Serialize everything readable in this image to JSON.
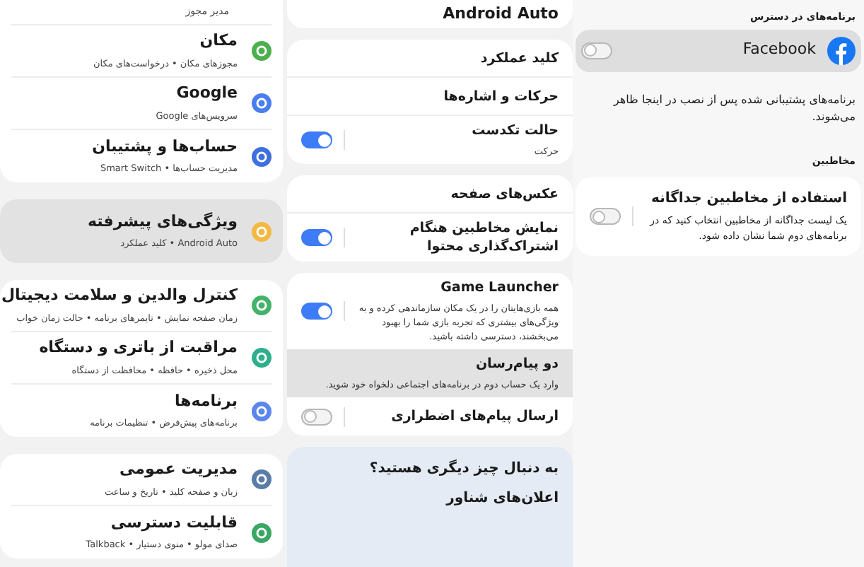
{
  "menu": {
    "top_subtitle": "مدیر مجوز",
    "cards": [
      {
        "highlighted": false,
        "items": [
          {
            "title": "مکان",
            "subtitle": "مجوزهای مکان • درخواست‌های مکان",
            "color": "#4caf50"
          },
          {
            "title": "Google",
            "subtitle": "سرویس‌های Google",
            "color": "#4a7ef0"
          },
          {
            "title": "حساب‌ها و پشتیبان",
            "subtitle": "مدیریت حساب‌ها • Smart Switch",
            "color": "#3f6fe0"
          }
        ]
      },
      {
        "highlighted": true,
        "items": [
          {
            "title": "ویژگی‌های پیشرفته",
            "subtitle": "Android Auto • کلید عملکرد",
            "color": "#f5b942"
          }
        ]
      },
      {
        "highlighted": false,
        "items": [
          {
            "title": "کنترل والدین و سلامت دیجیتال",
            "subtitle": "زمان صفحه نمایش • تایمرهای برنامه • حالت زمان خواب",
            "color": "#43b26a"
          },
          {
            "title": "مراقبت از باتری و دستگاه",
            "subtitle": "محل ذخیره • حافظه • محافظت از دستگاه",
            "color": "#2fae8c"
          },
          {
            "title": "برنامه‌ها",
            "subtitle": "برنامه‌های پیش‌فرض • تنظیمات برنامه",
            "color": "#5b86ee"
          }
        ]
      },
      {
        "highlighted": false,
        "items": [
          {
            "title": "مدیریت عمومی",
            "subtitle": "زبان و صفحه کلید • تاریخ و ساعت",
            "color": "#5a7da8"
          },
          {
            "title": "قابلیت دسترسی",
            "subtitle": "صدای مولو • منوی دستیار • Talkback",
            "color": "#3aa764"
          }
        ]
      }
    ]
  },
  "advanced": {
    "top_title": "Android Auto",
    "cards": [
      {
        "items": [
          {
            "kind": "plain",
            "title": "کلید عملکرد",
            "selected": false
          },
          {
            "kind": "plain",
            "title": "حرکات و اشاره‌ها",
            "selected": false
          },
          {
            "kind": "toggle",
            "title": "حالت تکدست",
            "subtitle": "حرکت",
            "on": true,
            "selected": false
          }
        ]
      },
      {
        "items": [
          {
            "kind": "plain",
            "title": "عکس‌های صفحه",
            "selected": false
          },
          {
            "kind": "toggle",
            "title": "نمایش مخاطبین هنگام اشتراک‌گذاری محتوا",
            "on": true,
            "selected": false
          }
        ]
      },
      {
        "items": [
          {
            "kind": "toggle",
            "title": "Game Launcher",
            "subtitle": "همه بازی‌هایتان را در یک مکان سازماندهی کرده و به ویژگی‌های بیشتری که تجربه بازی شما را بهبود می‌بخشند، دسترسی داشته باشید.",
            "on": true,
            "selected": false
          },
          {
            "kind": "plain",
            "title": "دو پیام‌رسان",
            "subtitle": "وارد یک حساب دوم در برنامه‌های اجتماعی دلخواه خود شوید.",
            "selected": true
          },
          {
            "kind": "toggle",
            "title": "ارسال پیام‌های اضطراری",
            "on": false,
            "selected": false
          }
        ]
      }
    ],
    "suggest": {
      "title": "به دنبال چیز دیگری هستید؟",
      "link": "اعلان‌های شناور"
    }
  },
  "dual": {
    "apps_header": "برنامه‌های در دسترس",
    "apps": [
      {
        "name": "Facebook",
        "on": false
      }
    ],
    "apps_note": "برنامه‌های پشتیبانی شده پس از نصب در اینجا ظاهر می‌شوند.",
    "contacts_header": "مخاطبین",
    "contacts": {
      "title": "استفاده از مخاطبین جداگانه",
      "subtitle": "یک لیست جداگانه از مخاطبین انتخاب کنید که در برنامه‌های دوم شما نشان داده شود.",
      "on": false
    }
  }
}
